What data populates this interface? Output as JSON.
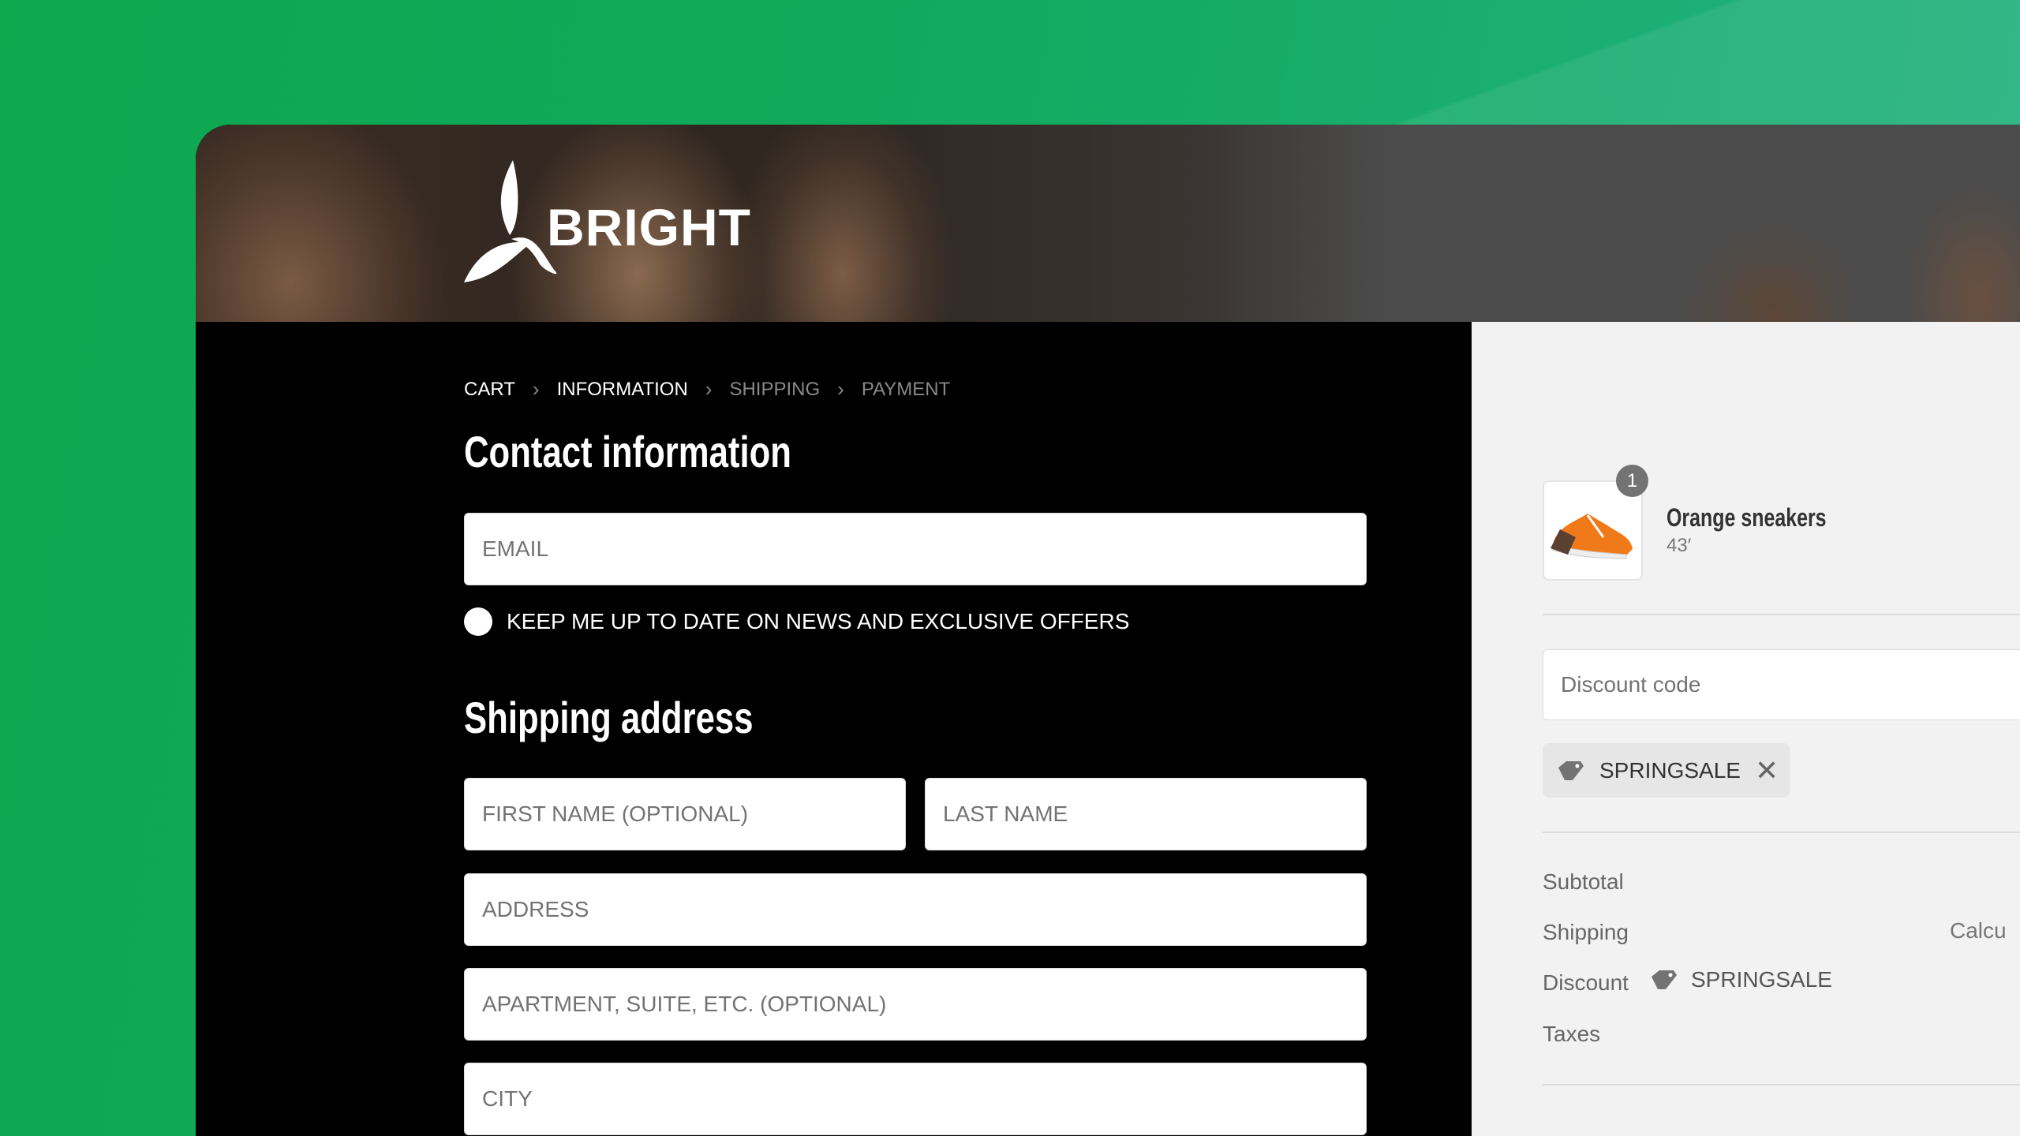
{
  "brand": {
    "name": "BRIGHT"
  },
  "breadcrumb": [
    {
      "label": "CART",
      "state": "done"
    },
    {
      "label": "INFORMATION",
      "state": "current"
    },
    {
      "label": "SHIPPING",
      "state": "upcoming"
    },
    {
      "label": "PAYMENT",
      "state": "upcoming"
    }
  ],
  "contact": {
    "title": "Contact information",
    "email_placeholder": "EMAIL",
    "newsletter_label": "KEEP ME UP TO DATE ON NEWS AND EXCLUSIVE OFFERS"
  },
  "shipping": {
    "title": "Shipping address",
    "first_name_placeholder": "FIRST NAME (OPTIONAL)",
    "last_name_placeholder": "LAST NAME",
    "address_placeholder": "ADDRESS",
    "apartment_placeholder": "APARTMENT, SUITE, ETC. (OPTIONAL)",
    "city_placeholder": "CITY"
  },
  "summary": {
    "product": {
      "name": "Orange sneakers",
      "variant": "43′",
      "quantity": "1"
    },
    "discount_placeholder": "Discount code",
    "applied_code": "SPRINGSALE",
    "rows": {
      "subtotal": "Subtotal",
      "shipping": "Shipping",
      "shipping_value": "Calcu",
      "discount": "Discount",
      "discount_code": "SPRINGSALE",
      "taxes": "Taxes"
    }
  },
  "colors": {
    "background": "#10a95c",
    "panel": "#000000",
    "summary_bg": "#f2f2f2",
    "accent_product": "#f07a1a"
  }
}
